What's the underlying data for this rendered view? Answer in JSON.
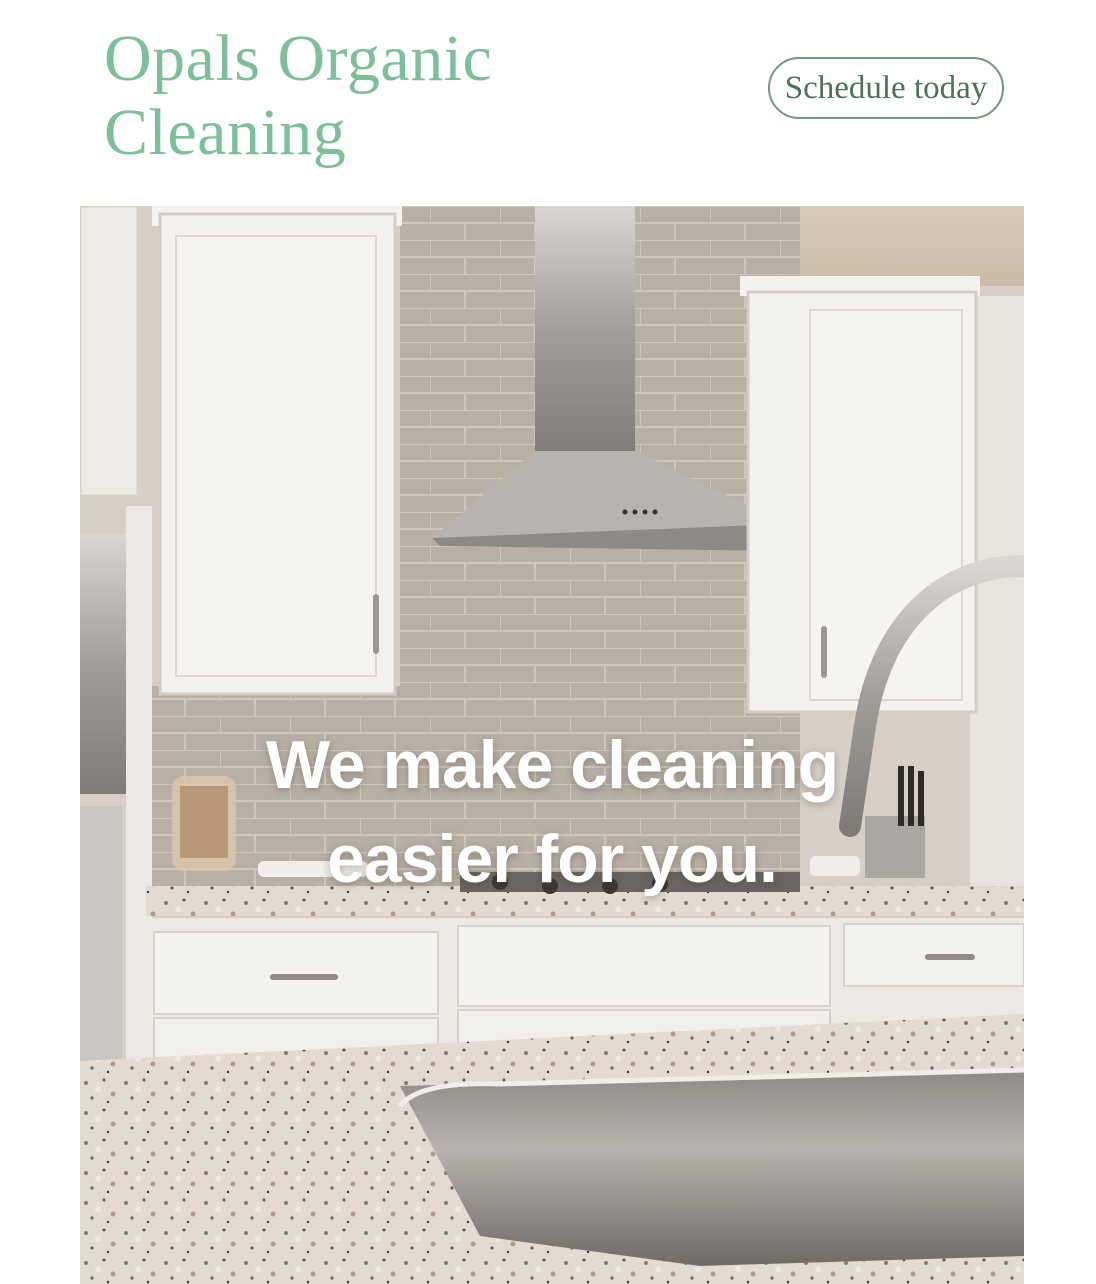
{
  "brand": {
    "line1": "Opals Organic",
    "line2": "Cleaning"
  },
  "cta": {
    "label": "Schedule today"
  },
  "hero": {
    "headline_line1": "We make cleaning",
    "headline_line2": "easier for you."
  },
  "colors": {
    "brand_green": "#7dbf98",
    "button_border": "#6f9a7e",
    "backsplash": "#b8afa4",
    "cabinet": "#f1efec",
    "granite": "#dcd3ca",
    "steel": "#a9a6a2"
  }
}
